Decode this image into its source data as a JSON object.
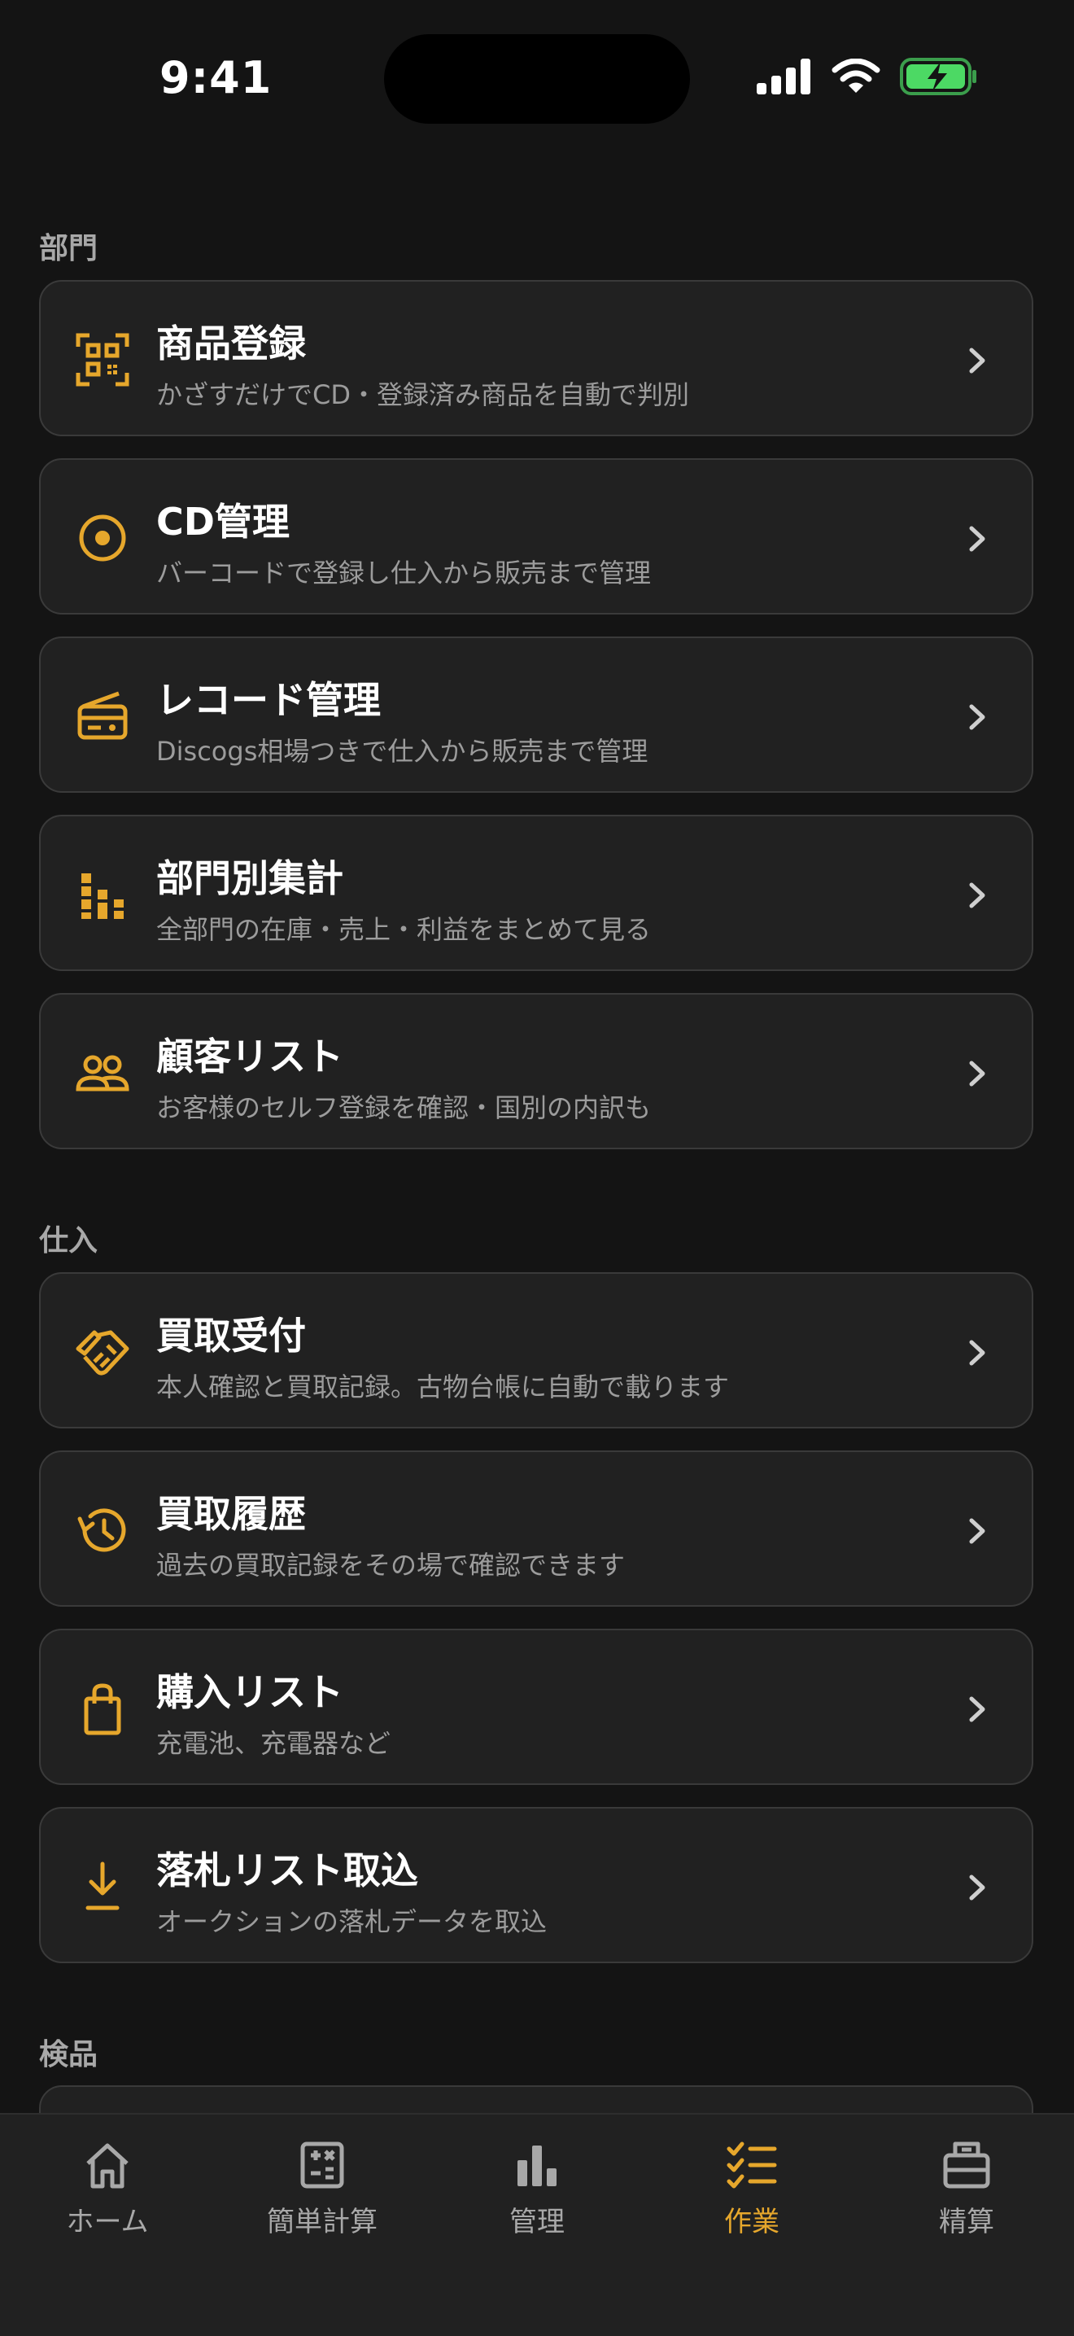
{
  "status_bar": {
    "time": "9:41"
  },
  "colors": {
    "accent": "#e6a72c",
    "background": "#141414",
    "card": "#212121",
    "battery": "#4cd964"
  },
  "sections": [
    {
      "title": "部門",
      "items": [
        {
          "title": "商品登録",
          "subtitle": "かざすだけでCD・登録済み商品を自動で判別",
          "icon": "qr-code-icon"
        },
        {
          "title": "CD管理",
          "subtitle": "バーコードで登録し仕入から販売まで管理",
          "icon": "disc-icon"
        },
        {
          "title": "レコード管理",
          "subtitle": "Discogs相場つきで仕入から販売まで管理",
          "icon": "radio-icon"
        },
        {
          "title": "部門別集計",
          "subtitle": "全部門の在庫・売上・利益をまとめて見る",
          "icon": "bar-stats-icon"
        },
        {
          "title": "顧客リスト",
          "subtitle": "お客様のセルフ登録を確認・国別の内訳も",
          "icon": "people-icon"
        }
      ]
    },
    {
      "title": "仕入",
      "items": [
        {
          "title": "買取受付",
          "subtitle": "本人確認と買取記録。古物台帳に自動で載ります",
          "icon": "handshake-icon"
        },
        {
          "title": "買取履歴",
          "subtitle": "過去の買取記録をその場で確認できます",
          "icon": "history-icon"
        },
        {
          "title": "購入リスト",
          "subtitle": "充電池、充電器など",
          "icon": "shopping-bag-icon"
        },
        {
          "title": "落札リスト取込",
          "subtitle": "オークションの落札データを取込",
          "icon": "download-icon"
        }
      ]
    },
    {
      "title": "検品",
      "items": []
    }
  ],
  "tab_bar": {
    "active": "作業",
    "tabs": [
      {
        "label": "ホーム",
        "icon": "home-icon"
      },
      {
        "label": "簡単計算",
        "icon": "calculator-icon"
      },
      {
        "label": "管理",
        "icon": "chart-icon"
      },
      {
        "label": "作業",
        "icon": "checklist-icon"
      },
      {
        "label": "精算",
        "icon": "register-icon"
      }
    ]
  }
}
